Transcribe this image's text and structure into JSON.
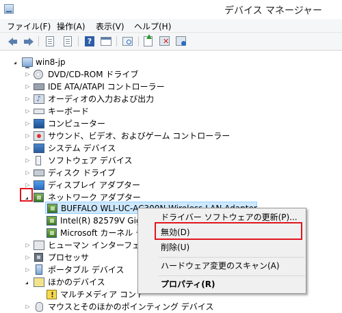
{
  "window": {
    "title": "デバイス マネージャー"
  },
  "menu": [
    "ファイル(F)",
    "操作(A)",
    "表示(V)",
    "ヘルプ(H)"
  ],
  "toolbar": {
    "icons": [
      "back-icon",
      "forward-icon",
      "properties-icon",
      "list-icon",
      "help-icon",
      "window-icon",
      "scan-icon",
      "update-driver-icon",
      "uninstall-icon",
      "disable-icon"
    ]
  },
  "tree": {
    "root": "win8-jp",
    "categories": [
      "DVD/CD-ROM ドライブ",
      "IDE ATA/ATAPI コントローラー",
      "オーディオの入力および出力",
      "キーボード",
      "コンピューター",
      "サウンド、ビデオ、およびゲーム コントローラー",
      "システム デバイス",
      "ソフトウェア デバイス",
      "ディスク ドライブ",
      "ディスプレイ アダプター",
      "ネットワーク アダプター"
    ],
    "network_children": [
      "BUFFALO WLI-UC-AC300N Wireless LAN Adapter",
      "Intel(R) 82579V Gig",
      "Microsoft カーネル デバ"
    ],
    "after_categories": [
      "ヒューマン インターフェイス デ",
      "プロセッサ",
      "ポータブル デバイス",
      "ほかのデバイス"
    ],
    "other_children": [
      "マルチメディア コントロー"
    ],
    "last_category": "マウスとそのほかのポインティング デバイス"
  },
  "context_menu": {
    "items": [
      "ドライバー ソフトウェアの更新(P)...",
      "無効(D)",
      "削除(U)",
      "ハードウェア変更のスキャン(A)",
      "プロパティ(R)"
    ]
  },
  "colors": {
    "highlight": "#e0141e",
    "selection": "#cde8ff"
  }
}
